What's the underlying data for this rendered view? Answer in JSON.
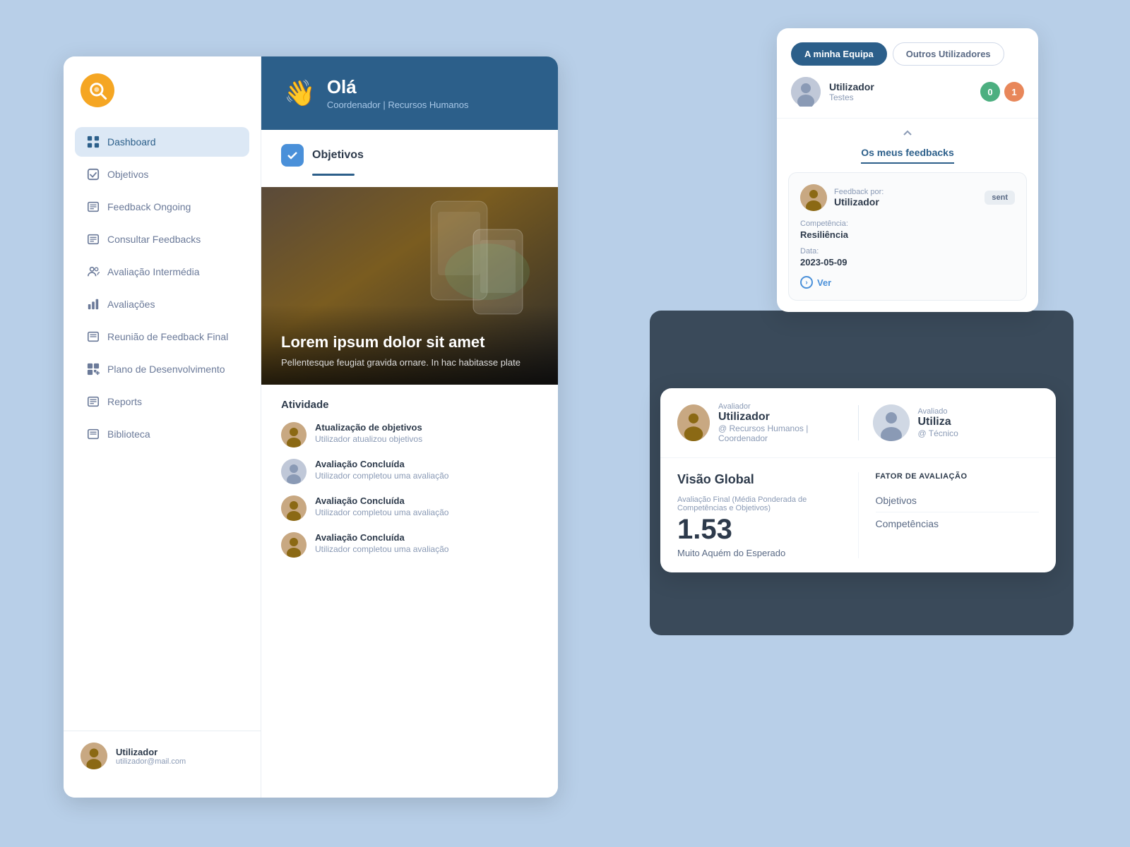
{
  "logo": {
    "icon": "🔍",
    "alt": "App Logo"
  },
  "sidebar": {
    "items": [
      {
        "id": "dashboard",
        "label": "Dashboard",
        "active": true,
        "icon": "grid"
      },
      {
        "id": "objetivos",
        "label": "Objetivos",
        "active": false,
        "icon": "check"
      },
      {
        "id": "feedback-ongoing",
        "label": "Feedback Ongoing",
        "active": false,
        "icon": "doc"
      },
      {
        "id": "consultar-feedbacks",
        "label": "Consultar Feedbacks",
        "active": false,
        "icon": "doc"
      },
      {
        "id": "avaliacao-intermedia",
        "label": "Avaliação Intermédia",
        "active": false,
        "icon": "people"
      },
      {
        "id": "avaliacoes",
        "label": "Avaliações",
        "active": false,
        "icon": "chart"
      },
      {
        "id": "reuniao-feedback-final",
        "label": "Reunião de Feedback Final",
        "active": false,
        "icon": "doc"
      },
      {
        "id": "plano-desenvolvimento",
        "label": "Plano de Desenvolvimento",
        "active": false,
        "icon": "grid4"
      },
      {
        "id": "reports",
        "label": "Reports",
        "active": false,
        "icon": "doc"
      },
      {
        "id": "biblioteca",
        "label": "Biblioteca",
        "active": false,
        "icon": "doc"
      }
    ]
  },
  "user": {
    "name": "Utilizador",
    "email": "utilizador@mail.com"
  },
  "welcome": {
    "greeting": "Olá",
    "role": "Coordenador | Recursos Humanos",
    "wave_icon": "👋"
  },
  "objectives_card": {
    "title": "Objetivos"
  },
  "hero": {
    "title": "Lorem ipsum dolor sit amet",
    "subtitle": "Pellentesque feugiat gravida ornare. In hac habitasse plate"
  },
  "activity": {
    "title": "Atividade",
    "items": [
      {
        "action": "Atualização de objetivos",
        "desc": "Utilizador atualizou objetivos",
        "avatar_type": "person"
      },
      {
        "action": "Avaliação Concluída",
        "desc": "Utilizador completou uma avaliação",
        "avatar_type": "gray"
      },
      {
        "action": "Avaliação Concluída",
        "desc": "Utilizador completou uma avaliação",
        "avatar_type": "person"
      },
      {
        "action": "Avaliação Concluída",
        "desc": "Utilizador completou uma avaliação",
        "avatar_type": "person"
      }
    ]
  },
  "feedback_panel": {
    "tabs": [
      {
        "label": "A minha Equipa",
        "active": true
      },
      {
        "label": "Outros Utilizadores",
        "active": false
      }
    ],
    "user": {
      "name": "Utilizador",
      "role": "Testes",
      "badge_green": "0",
      "badge_orange": "1"
    },
    "feedback_tab_label": "Os meus feedbacks",
    "feedback_card": {
      "by_label": "Feedback por:",
      "user_name": "Utilizador",
      "sent_badge": "sent",
      "competencia_label": "Competência:",
      "competencia_value": "Resiliência",
      "data_label": "Data:",
      "data_value": "2023-05-09",
      "ver_label": "Ver"
    }
  },
  "evaluation_panel": {
    "evaluator": {
      "role_label": "Avaliador",
      "name": "Utilizador",
      "dept": "@ Recursos Humanos | Coordenador"
    },
    "evaluated": {
      "role_label": "Avaliado",
      "name": "Utiliza",
      "dept": "@ Técnico"
    },
    "global": {
      "title": "Visão Global",
      "score_label": "Avaliação Final (Média Ponderada de Competências e Objetivos)",
      "score": "1.53",
      "score_desc": "Muito Aquém do Esperado"
    },
    "factors": {
      "title": "FATOR DE AVALIAÇÃO",
      "items": [
        "Objetivos",
        "Competências"
      ]
    }
  }
}
